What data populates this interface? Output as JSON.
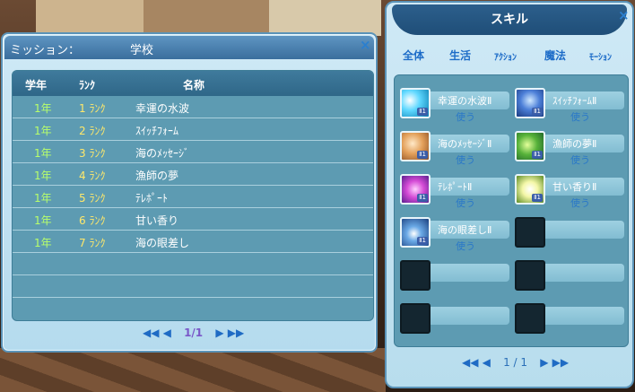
{
  "mission": {
    "title_label": "ミッション：",
    "title_value": "学校",
    "close": "×",
    "columns": {
      "year": "学年",
      "rank": "ﾗﾝｸ",
      "name": "名称"
    },
    "rows": [
      {
        "year": "1年",
        "rank": "1 ﾗﾝｸ",
        "name": "幸運の水波"
      },
      {
        "year": "1年",
        "rank": "2 ﾗﾝｸ",
        "name": "ｽｲｯﾁﾌｫｰﾑ"
      },
      {
        "year": "1年",
        "rank": "3 ﾗﾝｸ",
        "name": "海のﾒｯｾｰｼﾞ"
      },
      {
        "year": "1年",
        "rank": "4 ﾗﾝｸ",
        "name": "漁師の夢"
      },
      {
        "year": "1年",
        "rank": "5 ﾗﾝｸ",
        "name": "ﾃﾚﾎﾟｰﾄ"
      },
      {
        "year": "1年",
        "rank": "6 ﾗﾝｸ",
        "name": "甘い香り"
      },
      {
        "year": "1年",
        "rank": "7 ﾗﾝｸ",
        "name": "海の眼差し"
      }
    ],
    "pager": {
      "first": "◀◀",
      "prev": "◀",
      "page": "1/1",
      "next": "▶",
      "last": "▶▶"
    }
  },
  "skill": {
    "title": "スキル",
    "close": "×",
    "tabs": [
      "全体",
      "生活",
      "ｱｸｼｮﾝ",
      "魔法",
      "ﾓｰｼｮﾝ"
    ],
    "use_label": "使う",
    "items": [
      {
        "name": "幸運の水波Ⅱ",
        "icon": "water-wave-icon",
        "level": "Ⅱ1"
      },
      {
        "name": "ｽｲｯﾁﾌｫｰﾑⅡ",
        "icon": "switch-form-icon",
        "level": "Ⅱ1"
      },
      {
        "name": "海のﾒｯｾｰｼﾞⅡ",
        "icon": "sea-message-icon",
        "level": "Ⅱ1"
      },
      {
        "name": "漁師の夢Ⅱ",
        "icon": "fisherman-dream-icon",
        "level": "Ⅱ1"
      },
      {
        "name": "ﾃﾚﾎﾟｰﾄⅡ",
        "icon": "teleport-icon",
        "level": "Ⅱ1"
      },
      {
        "name": "甘い香りⅡ",
        "icon": "sweet-scent-icon",
        "level": "Ⅱ1"
      },
      {
        "name": "海の眼差しⅡ",
        "icon": "sea-gaze-icon",
        "level": "Ⅱ1"
      }
    ],
    "pager": {
      "first": "◀◀",
      "prev": "◀",
      "page": "1 / 1",
      "next": "▶",
      "last": "▶▶"
    }
  }
}
